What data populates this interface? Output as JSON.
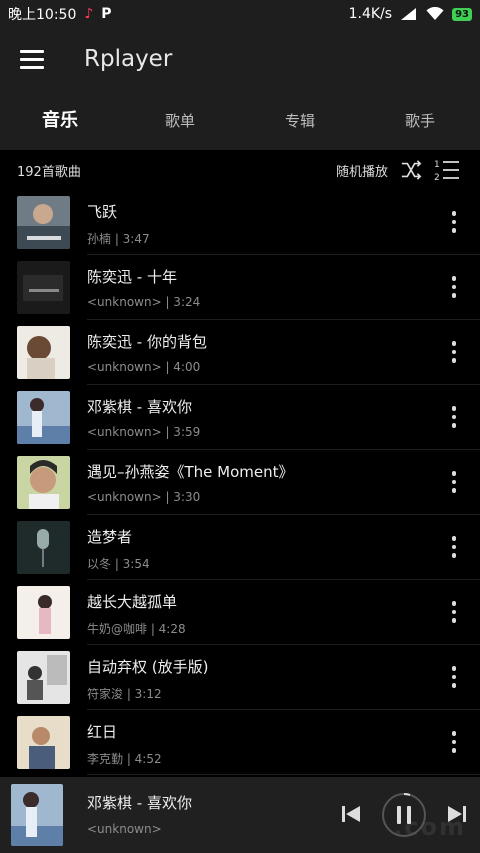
{
  "status": {
    "time": "晚上10:50",
    "speed": "1.4K/s",
    "battery": "93"
  },
  "app": {
    "title": "Rplayer"
  },
  "tabs": [
    "音乐",
    "歌单",
    "专辑",
    "歌手"
  ],
  "toolbar": {
    "count": "192首歌曲",
    "shuffle": "随机播放"
  },
  "songs": [
    {
      "title": "飞跃",
      "sub": "孙楠 | 3:47"
    },
    {
      "title": "陈奕迅 - 十年",
      "sub": "<unknown> | 3:24"
    },
    {
      "title": "陈奕迅 - 你的背包",
      "sub": "<unknown> | 4:00"
    },
    {
      "title": "邓紫棋 - 喜欢你",
      "sub": "<unknown> | 3:59"
    },
    {
      "title": "遇见–孙燕姿《The Moment》",
      "sub": "<unknown> | 3:30"
    },
    {
      "title": "造梦者",
      "sub": "以冬 | 3:54"
    },
    {
      "title": "越长大越孤单",
      "sub": "牛奶@咖啡 | 4:28"
    },
    {
      "title": "自动弃权 (放手版)",
      "sub": "符家浚 | 3:12"
    },
    {
      "title": "红日",
      "sub": "李克勤 | 4:52"
    }
  ],
  "player": {
    "title": "邓紫棋 - 喜欢你",
    "artist": "<unknown>"
  },
  "colors": {
    "accent": "#3ecf55",
    "background": "#000000",
    "bar": "#1e1e1e"
  }
}
